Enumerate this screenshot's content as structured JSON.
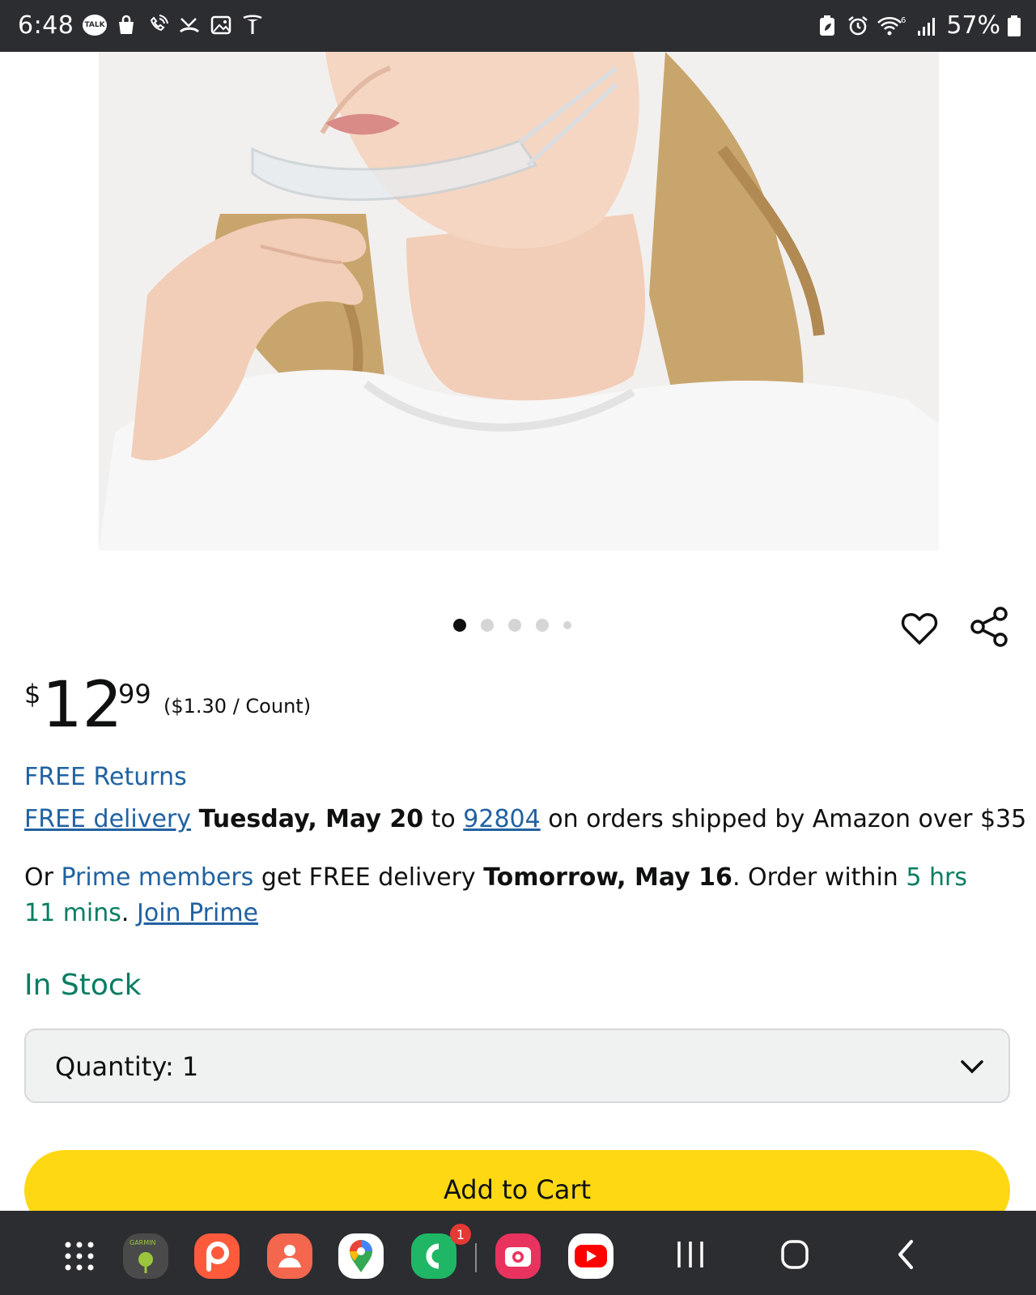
{
  "status_bar": {
    "time": "6:48",
    "talk_label": "TALK",
    "network_type": "6",
    "battery_percent": "57%",
    "left_icons": [
      "talk-icon",
      "shopping-bag-icon",
      "wifi-call-icon",
      "missed-call-icon",
      "gallery-icon",
      "tesla-icon"
    ],
    "right_icons": [
      "battery-saver-icon",
      "alarm-icon",
      "wifi-icon",
      "signal-icon",
      "battery-icon"
    ]
  },
  "carousel": {
    "total": 5,
    "active_index": 0
  },
  "product": {
    "price_symbol": "$",
    "price_whole": "12",
    "price_fraction": "99",
    "unit_price": "($1.30 / Count)"
  },
  "shipping": {
    "free_returns": "FREE Returns",
    "free_delivery_link": "FREE delivery",
    "delivery_date": "Tuesday, May 20",
    "to_text": " to ",
    "zip": "92804",
    "delivery_suffix": " on orders shipped by Amazon over $35",
    "prime_prefix": "Or ",
    "prime_members": "Prime members",
    "prime_middle": " get FREE delivery ",
    "prime_date": "Tomorrow, May 16",
    "prime_order_within": ". Order within ",
    "prime_countdown": "5 hrs 11 mins",
    "prime_period": ". ",
    "join_prime": "Join Prime"
  },
  "availability": "In Stock",
  "quantity": {
    "label": "Quantity:",
    "value": "1"
  },
  "add_to_cart": "Add to Cart",
  "nav_bar": {
    "apps": [
      "app-drawer-icon",
      "garmin-golf-icon",
      "picsart-icon",
      "contacts-icon",
      "google-maps-icon",
      "phone-call-icon",
      "camera-icon",
      "youtube-icon"
    ],
    "garmin_label": "GARMIN",
    "phone_badge": "1"
  },
  "colors": {
    "link": "#2162a1",
    "green": "#067d62",
    "cart_button": "#ffd814",
    "system_bar": "#2b2d31"
  }
}
